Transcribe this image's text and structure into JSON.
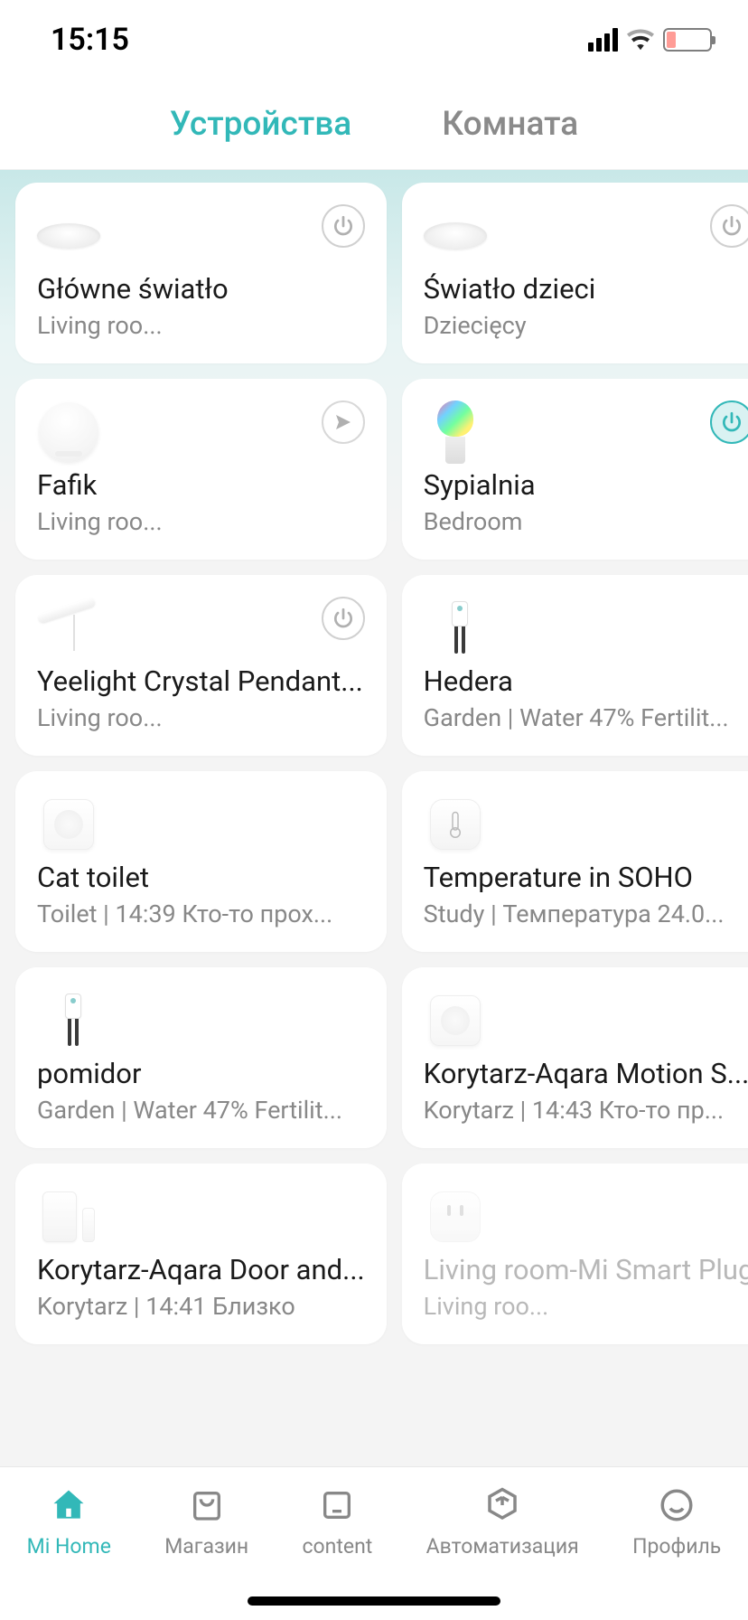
{
  "status": {
    "time": "15:15"
  },
  "tabs": {
    "devices": "Устройства",
    "rooms": "Комната"
  },
  "devices": [
    {
      "name": "Główne światło",
      "sub": "Living roo...",
      "icon": "ceiling-lamp",
      "action": "power",
      "power_on": false
    },
    {
      "name": "Światło dzieci",
      "sub": "Dziecięcy",
      "icon": "ceiling-lamp-big",
      "action": "power",
      "power_on": false
    },
    {
      "name": "Fafik",
      "sub": "Living roo...",
      "icon": "vacuum",
      "action": "locate"
    },
    {
      "name": "Sypialnia",
      "sub": "Bedroom",
      "icon": "bulb",
      "action": "power",
      "power_on": true
    },
    {
      "name": "Yeelight Crystal Pendant...",
      "sub": "Living roo...",
      "icon": "pendant",
      "action": "power",
      "power_on": false
    },
    {
      "name": "Hedera",
      "sub": "Garden | Water 47% Fertilit...",
      "icon": "plant-sensor"
    },
    {
      "name": "Cat toilet",
      "sub": "Toilet | 14:39 Кто-то прох...",
      "icon": "motion-sensor"
    },
    {
      "name": "Temperature in SOHO",
      "sub": "Study | Температура 24.0...",
      "icon": "temp-sensor"
    },
    {
      "name": "pomidor",
      "sub": "Garden | Water 47% Fertilit...",
      "icon": "plant-sensor"
    },
    {
      "name": "Korytarz-Aqara Motion S...",
      "sub": "Korytarz | 14:43 Кто-то пр...",
      "icon": "motion-sensor"
    },
    {
      "name": "Korytarz-Aqara Door and...",
      "sub": "Korytarz | 14:41 Близко",
      "icon": "door-sensor"
    },
    {
      "name": "Living room-Mi Smart Plug",
      "sub": "Living roo...",
      "icon": "plug",
      "offline": true
    }
  ],
  "nav": {
    "home": "Mi Home",
    "store": "Магазин",
    "content": "content",
    "automation": "Автоматизация",
    "profile": "Профиль"
  }
}
